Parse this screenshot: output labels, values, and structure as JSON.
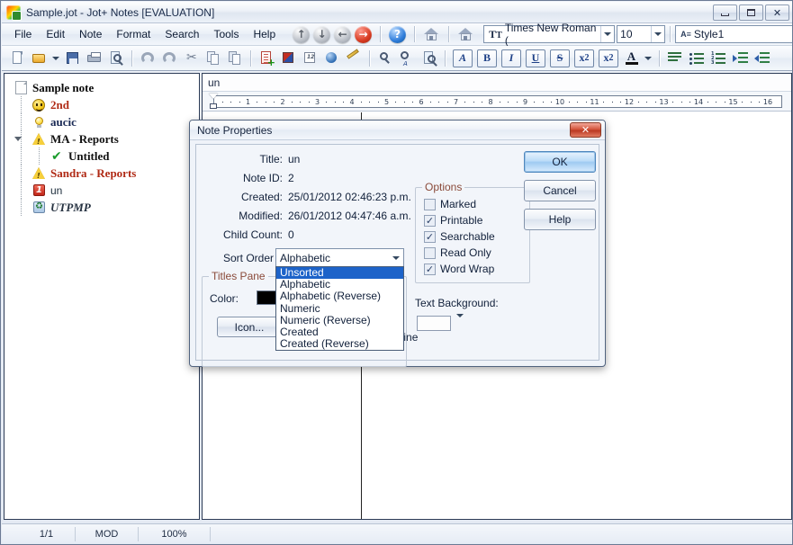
{
  "window": {
    "title": "Sample.jot - Jot+ Notes [EVALUATION]",
    "minimize_label": "Minimize",
    "maximize_label": "Maximize",
    "close_label": "✕"
  },
  "menubar": {
    "items": [
      {
        "label": "File"
      },
      {
        "label": "Edit"
      },
      {
        "label": "Note"
      },
      {
        "label": "Format"
      },
      {
        "label": "Search"
      },
      {
        "label": "Tools"
      },
      {
        "label": "Help"
      }
    ],
    "nav_icons": [
      "arrow-up-icon",
      "arrow-down-icon",
      "arrow-back-icon",
      "arrow-forward-icon"
    ],
    "nav_glyphs": {
      "up": "↑",
      "down": "↓",
      "back": "←",
      "forward": "→",
      "help": "?"
    },
    "font_name": "Times New Roman (",
    "font_size": "10",
    "style_name": "Style1"
  },
  "toolbar": {
    "buttons": [
      "new-icon",
      "open-icon",
      "open-dropdown-icon",
      "save-icon",
      "print-icon",
      "print-preview-icon",
      "undo-icon",
      "redo-icon",
      "cut-icon",
      "copy-icon",
      "paste-icon",
      "new-note-icon",
      "note-book-icon",
      "date-note-icon",
      "web-note-icon",
      "highlight-icon",
      "find-icon",
      "find-replace-icon",
      "find-next-icon",
      "font-icon",
      "bold-icon",
      "italic-icon",
      "underline-icon",
      "strikethrough-icon",
      "superscript-icon",
      "subscript-icon",
      "font-color-icon",
      "font-color-dropdown-icon",
      "paragraph-icon",
      "bullet-list-icon",
      "numbered-list-icon",
      "indent-increase-icon",
      "indent-decrease-icon"
    ],
    "format_labels": {
      "font": "A",
      "bold": "B",
      "italic": "I",
      "underline": "U",
      "strike": "S",
      "sup": "x",
      "sup_small": "2",
      "sub": "x",
      "sub_small": "2",
      "color": "A"
    }
  },
  "tree": {
    "items": [
      {
        "label": "Sample note",
        "icon": "document-icon",
        "style": "root",
        "indent": 0
      },
      {
        "label": "2nd",
        "icon": "smiley-icon",
        "style": "red-bold",
        "indent": 1
      },
      {
        "label": "aucic",
        "icon": "lightbulb-icon",
        "style": "navy-bold",
        "indent": 1
      },
      {
        "label": "MA - Reports",
        "icon": "warning-icon",
        "style": "dark-bold",
        "indent": 1,
        "expander": true
      },
      {
        "label": "Untitled",
        "icon": "check-icon",
        "style": "dark-bold",
        "indent": 2
      },
      {
        "label": "Sandra - Reports",
        "icon": "warning-icon",
        "style": "red-bold",
        "indent": 1
      },
      {
        "label": "un",
        "icon": "number-one-icon",
        "style": "plain",
        "indent": 1,
        "badge": "1"
      },
      {
        "label": "UTPMP",
        "icon": "recycle-icon",
        "style": "italic",
        "indent": 1
      }
    ]
  },
  "editor": {
    "note_title": "un",
    "ruler_ticks": [
      "1",
      "2",
      "3",
      "4",
      "5",
      "6",
      "7",
      "8",
      "9",
      "10",
      "11",
      "12",
      "13",
      "14",
      "15",
      "16"
    ],
    "content": ""
  },
  "statusbar": {
    "page": "1/1",
    "mode": "MOD",
    "zoom": "100%"
  },
  "dialog": {
    "title": "Note Properties",
    "close_label": "✕",
    "fields": [
      {
        "label": "Title:",
        "value": "un"
      },
      {
        "label": "Note ID:",
        "value": "2"
      },
      {
        "label": "Created:",
        "value": "25/01/2012 02:46:23 p.m."
      },
      {
        "label": "Modified:",
        "value": "26/01/2012 04:47:46 a.m."
      },
      {
        "label": "Child Count:",
        "value": "0"
      }
    ],
    "sort_order": {
      "label": "Sort Order",
      "value": "Alphabetic",
      "options": [
        "Unsorted",
        "Alphabetic",
        "Alphabetic (Reverse)",
        "Numeric",
        "Numeric (Reverse)",
        "Created",
        "Created (Reverse)"
      ],
      "highlighted": "Unsorted"
    },
    "titles_pane": {
      "group_label": "Titles Pane",
      "color_label": "Color:",
      "color_value": "#000000",
      "icon_button_label": "Icon...",
      "underline_label": "Underline"
    },
    "options": {
      "group_label": "Options",
      "items": [
        {
          "label": "Marked",
          "checked": false
        },
        {
          "label": "Printable",
          "checked": true
        },
        {
          "label": "Searchable",
          "checked": true
        },
        {
          "label": "Read Only",
          "checked": false
        },
        {
          "label": "Word Wrap",
          "checked": true
        }
      ]
    },
    "text_background": {
      "label": "Text Background:",
      "color_value": "#ffffff"
    },
    "buttons": [
      {
        "label": "OK",
        "default": true
      },
      {
        "label": "Cancel",
        "default": false
      },
      {
        "label": "Help",
        "default": false
      }
    ]
  },
  "colors": {
    "accent": "#1d63c9",
    "title_text": "#16243d",
    "group_label": "#8a4a3a",
    "tree_red": "#b02a15",
    "tree_navy": "#1a2a55"
  }
}
